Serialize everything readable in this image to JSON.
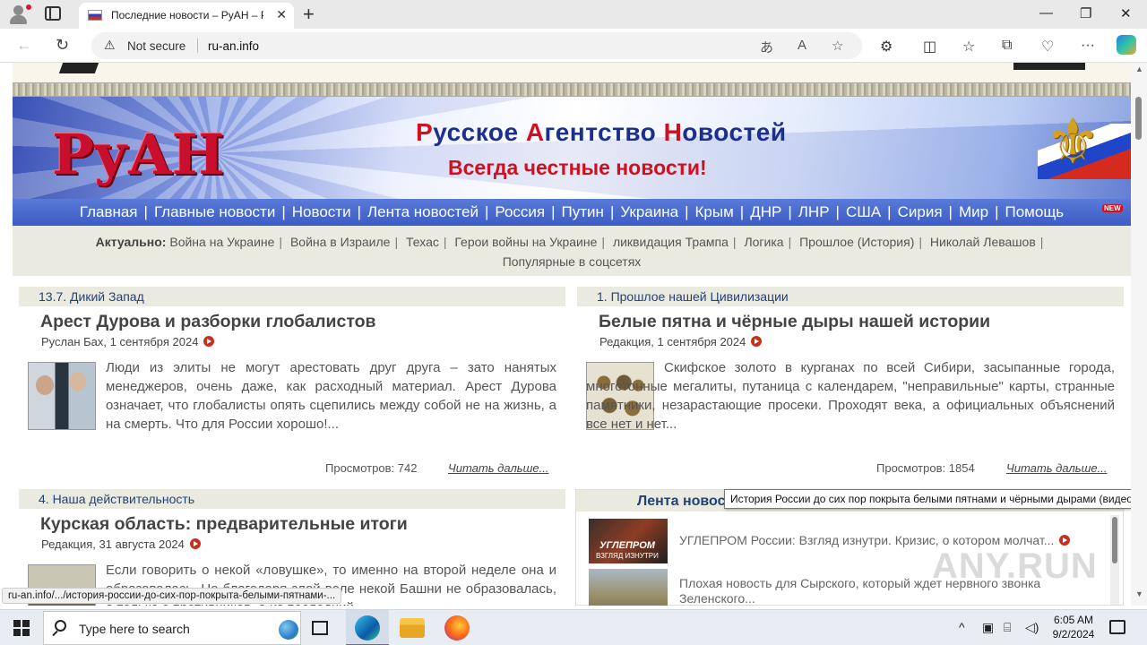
{
  "browser": {
    "tab_title": "Последние новости – РуАН – Ру",
    "not_secure": "Not secure",
    "url": "ru-an.info"
  },
  "site": {
    "logo": "РуАН",
    "title_parts": [
      {
        "text": "Р",
        "red": true
      },
      {
        "text": "усское ",
        "red": false
      },
      {
        "text": "А",
        "red": true
      },
      {
        "text": "гентство ",
        "red": false
      },
      {
        "text": "Н",
        "red": true
      },
      {
        "text": "овостей",
        "red": false
      }
    ],
    "subtitle": "Всегда честные новости!",
    "menu": [
      "Главная",
      "Главные новости",
      "Новости",
      "Лента новостей",
      "Россия",
      "Путин",
      "Украина",
      "Крым",
      "ДНР",
      "ЛНР",
      "США",
      "Сирия",
      "Мир",
      "Помощь"
    ],
    "menu_new_badge": "NEW",
    "aktual_label": "Актуально:",
    "aktual_links": [
      "Война на Украине",
      "Война в Израиле",
      "Техас",
      "Герои войны на Украине",
      "ликвидация Трампа",
      "Логика",
      "Прошлое (История)",
      "Николай Левашов",
      "Популярные в соцсетях"
    ]
  },
  "articles": [
    {
      "category": "13.7. Дикий Запад",
      "title": "Арест Дурова и разборки глобалистов",
      "meta": "Руслан Бах, 1 сентября 2024",
      "text": "Люди из элиты не могут арестовать друг друга – зато нанятых менеджеров, очень даже, как расходный материал. Арест Дурова означает, что глобалисты опять сцепились между собой не на жизнь, а на смерть. Что для России хорошо!...",
      "views_label": "Просмотров:",
      "views": "742",
      "more": "Читать дальше..."
    },
    {
      "category": "1. Прошлое нашей Цивилизации",
      "title": "Белые пятна и чёрные дыры нашей истории",
      "meta": "Редакция, 1 сентября 2024",
      "text": "Скифское золото в курганах по всей Сибири, засыпанные города, многотонные мегалиты, путаница с календарем, \"неправильные\" карты, странные памятники, незарастающие просеки. Проходят века, а официальных объяснений все нет и нет...",
      "views_label": "Просмотров:",
      "views": "1854",
      "more": "Читать дальше..."
    },
    {
      "category": "4. Наша действительность",
      "title": "Курская область: предварительные итоги",
      "meta": "Редакция, 31 августа 2024",
      "text": "Если говорить о некой «ловушке», то именно на второй неделе она и образовалась. Но благодаря злой воле некой Башни не образовалась, а только с противников, а из последний"
    }
  ],
  "lenta": {
    "heading": "Лента новостей",
    "items": [
      {
        "image_caption_1": "УГЛЕПРОМ",
        "image_caption_2": "ВЗГЛЯД ИЗНУТРИ",
        "text": "УГЛЕПРОМ России: Взгляд изнутри. Кризис, о котором молчат..."
      },
      {
        "text": "Плохая новость для Сырского, который ждет нервного звонка Зеленского..."
      }
    ]
  },
  "tooltip": "История России до сих пор покрыта белыми пятнами и чёрными дырами (видео)",
  "status_url": "ru-an.info/.../история-россии-до-сих-пор-покрыта-белыми-пятнами-...",
  "watermark": "ANY.RUN",
  "taskbar": {
    "search_placeholder": "Type here to search",
    "time": "6:05 AM",
    "date": "9/2/2024"
  }
}
